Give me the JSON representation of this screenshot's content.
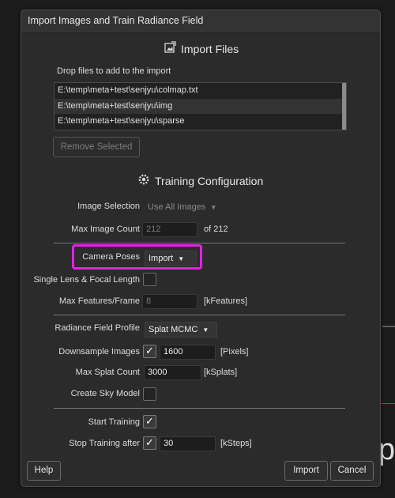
{
  "window": {
    "title": "Import Images and Train Radiance Field"
  },
  "import_files": {
    "header": "Import Files",
    "drop_hint": "Drop files to add to the import",
    "files": [
      {
        "path": "E:\\temp\\meta+test\\senjyu\\colmap.txt"
      },
      {
        "path": "E:\\temp\\meta+test\\senjyu\\img"
      },
      {
        "path": "E:\\temp\\meta+test\\senjyu\\sparse"
      }
    ],
    "remove_selected_label": "Remove Selected"
  },
  "training": {
    "header": "Training Configuration",
    "image_selection_label": "Image Selection",
    "image_selection_value": "Use All Images",
    "max_image_count_label": "Max Image Count",
    "max_image_count_value": "212",
    "max_image_count_suffix": "of 212",
    "camera_poses_label": "Camera Poses",
    "camera_poses_value": "Import",
    "single_lens_label": "Single Lens & Focal Length",
    "max_features_label": "Max Features/Frame",
    "max_features_value": "8",
    "max_features_unit": "[kFeatures]",
    "profile_label": "Radiance Field Profile",
    "profile_value": "Splat MCMC",
    "downsample_label": "Downsample Images",
    "downsample_value": "1600",
    "downsample_unit": "[Pixels]",
    "max_splat_label": "Max Splat Count",
    "max_splat_value": "3000",
    "max_splat_unit": "[kSplats]",
    "sky_model_label": "Create Sky Model",
    "start_training_label": "Start Training",
    "stop_training_label": "Stop Training after",
    "stop_training_value": "30",
    "stop_training_unit": "[kSteps]"
  },
  "buttons": {
    "help": "Help",
    "import": "Import",
    "cancel": "Cancel"
  },
  "background": {
    "partial_text": "p"
  },
  "colors": {
    "highlight": "#e620e6",
    "dialog_bg": "#2b2b2b"
  }
}
